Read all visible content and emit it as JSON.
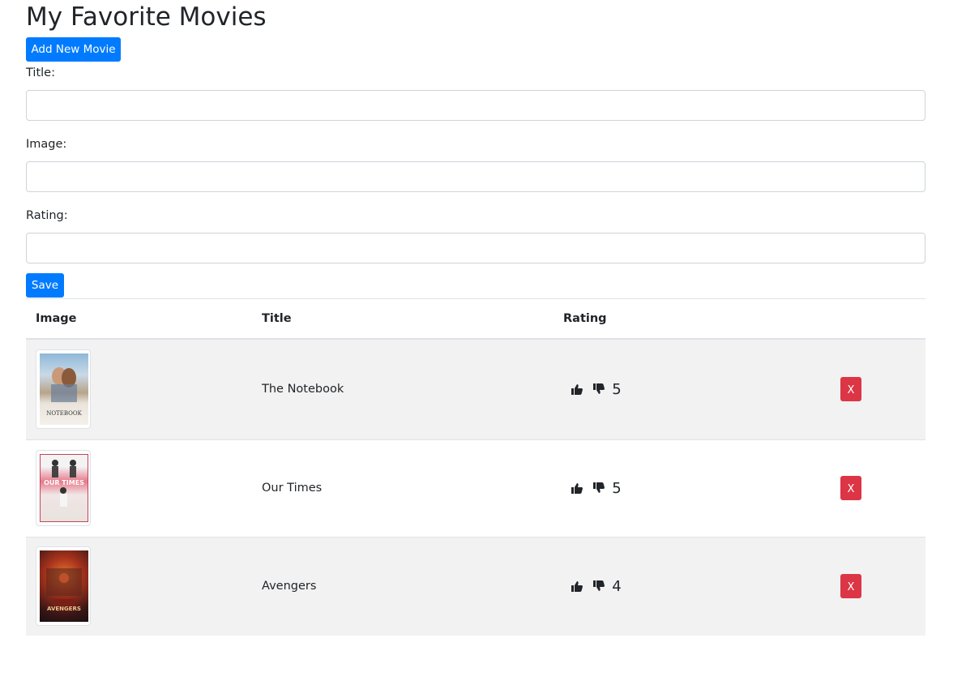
{
  "page": {
    "title": "My Favorite Movies",
    "add_button_label": "Add New Movie"
  },
  "form": {
    "title_label": "Title:",
    "title_value": "",
    "image_label": "Image:",
    "image_value": "",
    "rating_label": "Rating:",
    "rating_value": "",
    "save_label": "Save"
  },
  "table": {
    "headers": [
      "Image",
      "Title",
      "Rating",
      ""
    ],
    "rows": [
      {
        "image_icon": "poster-the-notebook",
        "title": "The Notebook",
        "poster_text": "NOTEBOOK",
        "rating": "5",
        "delete_label": "X"
      },
      {
        "image_icon": "poster-our-times",
        "title": "Our Times",
        "poster_text": "OUR TIMES",
        "rating": "5",
        "delete_label": "X"
      },
      {
        "image_icon": "poster-avengers",
        "title": "Avengers",
        "poster_text": "AVENGERS",
        "rating": "4",
        "delete_label": "X"
      }
    ]
  },
  "colors": {
    "primary": "#007bff",
    "danger": "#dc3545",
    "stripe": "#f2f2f2"
  }
}
